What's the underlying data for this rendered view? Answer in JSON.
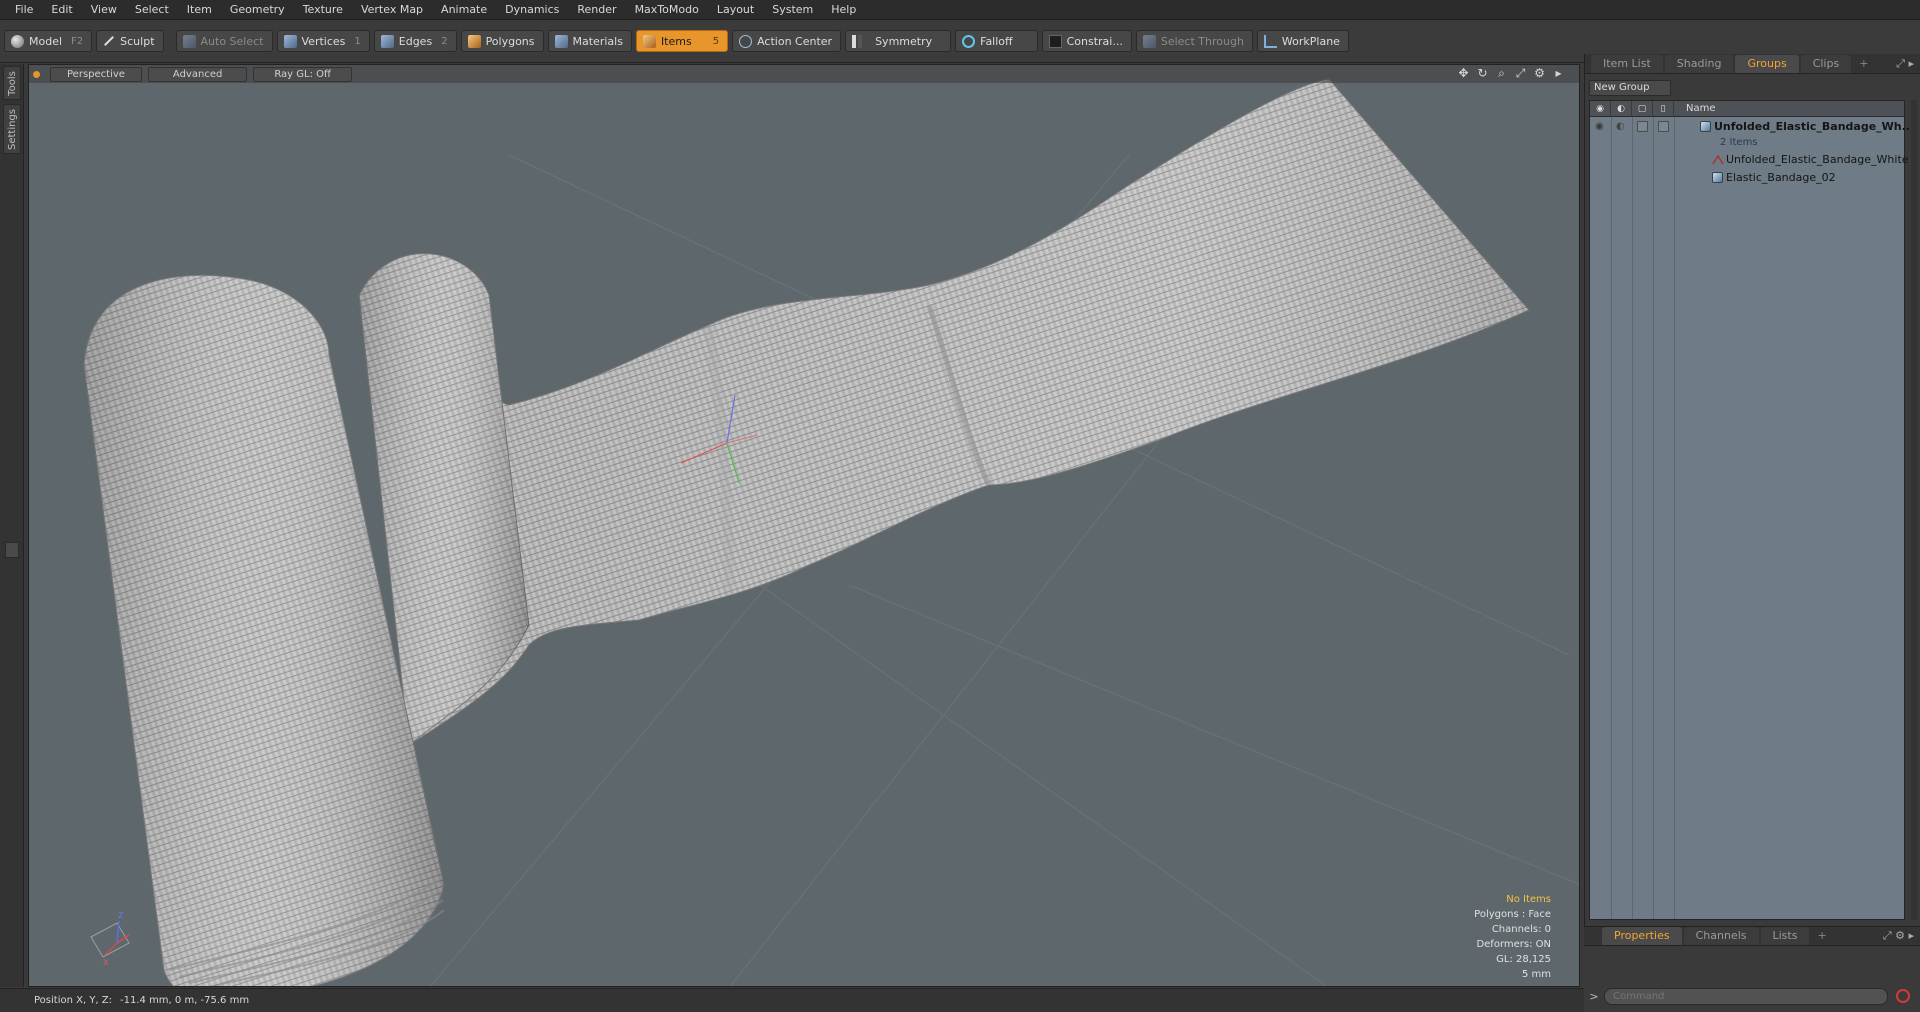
{
  "menu": [
    "File",
    "Edit",
    "View",
    "Select",
    "Item",
    "Geometry",
    "Texture",
    "Vertex Map",
    "Animate",
    "Dynamics",
    "Render",
    "MaxToModo",
    "Layout",
    "System",
    "Help"
  ],
  "toolbar": {
    "model": "Model",
    "model_key": "F2",
    "sculpt": "Sculpt",
    "auto_select": "Auto Select",
    "vertices": "Vertices",
    "vertices_key": "1",
    "edges": "Edges",
    "edges_key": "2",
    "polygons": "Polygons",
    "materials": "Materials",
    "items": "Items",
    "items_key": "5",
    "action_center": "Action Center",
    "symmetry": "Symmetry",
    "falloff": "Falloff",
    "constraints": "Constrai...",
    "select_through": "Select Through",
    "workplane": "WorkPlane"
  },
  "left_strip": {
    "tools": "Tools",
    "settings": "Settings"
  },
  "viewport": {
    "view_mode": "Perspective",
    "shading": "Advanced",
    "raygl": "Ray GL: Off",
    "info": {
      "selection": "No Items",
      "polygons": "Polygons : Face",
      "channels": "Channels: 0",
      "deformers": "Deformers: ON",
      "gl": "GL: 28,125",
      "grid": "5 mm"
    },
    "axis_labels": {
      "x": "X",
      "y": "Y",
      "z": "Z"
    }
  },
  "right_panel": {
    "tabs": [
      "Item List",
      "Shading",
      "Groups",
      "Clips"
    ],
    "active_tab": "Groups",
    "new_group": "New Group",
    "column_name": "Name",
    "group": {
      "name": "Unfolded_Elastic_Bandage_Wh...",
      "count": "2 Items",
      "children": [
        "Unfolded_Elastic_Bandage_White",
        "Elastic_Bandage_02"
      ]
    },
    "bottom_tabs": [
      "Properties",
      "Channels",
      "Lists"
    ],
    "active_bottom_tab": "Properties",
    "command_placeholder": "Command"
  },
  "status": {
    "label": "Position X, Y, Z:",
    "value": "-11.4 mm, 0 m, -75.6 mm"
  },
  "colors": {
    "accent": "#e8962c",
    "viewport_bg": "#5e676c",
    "group_list_bg": "#6f7b86"
  }
}
